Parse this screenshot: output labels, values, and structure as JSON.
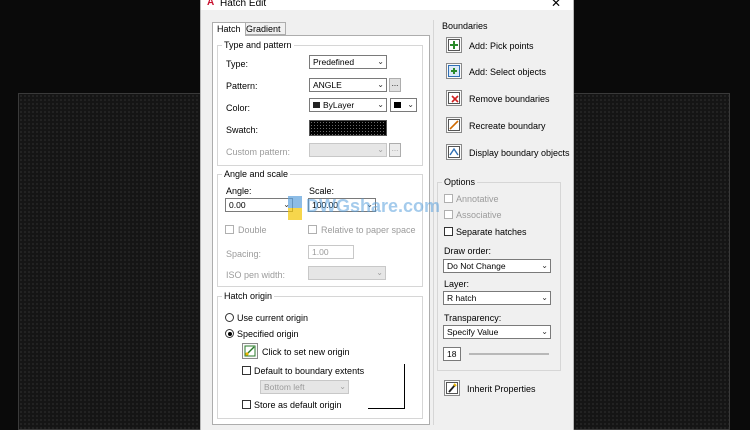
{
  "window": {
    "title": "Hatch Edit",
    "close": "✕"
  },
  "tabs": [
    {
      "label": "Hatch",
      "active": true
    },
    {
      "label": "Gradient",
      "active": false
    }
  ],
  "type_and_pattern": {
    "legend": "Type and pattern",
    "type_label": "Type:",
    "type_value": "Predefined",
    "pattern_label": "Pattern:",
    "pattern_value": "ANGLE",
    "pattern_browse": "...",
    "color_label": "Color:",
    "color_value": "ByLayer",
    "swatch_label": "Swatch:",
    "custom_pattern_label": "Custom pattern:",
    "custom_browse": "..."
  },
  "angle_and_scale": {
    "legend": "Angle and scale",
    "angle_label": "Angle:",
    "angle_value": "0.00",
    "scale_label": "Scale:",
    "scale_value": "100.00",
    "double_label": "Double",
    "relative_label": "Relative to paper space",
    "spacing_label": "Spacing:",
    "spacing_value": "1.00",
    "iso_label": "ISO pen width:"
  },
  "hatch_origin": {
    "legend": "Hatch origin",
    "use_current": "Use current origin",
    "specified": "Specified origin",
    "click_set": "Click to set new origin",
    "default_boundary": "Default to boundary extents",
    "bottom_left": "Bottom left",
    "store_default": "Store as default origin"
  },
  "boundaries": {
    "title": "Boundaries",
    "add_pick": "Add: Pick points",
    "add_select": "Add: Select objects",
    "remove": "Remove boundaries",
    "recreate": "Recreate boundary",
    "display": "Display boundary objects"
  },
  "options": {
    "title": "Options",
    "annotative": "Annotative",
    "associative": "Associative",
    "separate": "Separate hatches",
    "draw_order_label": "Draw order:",
    "draw_order_value": "Do Not Change",
    "layer_label": "Layer:",
    "layer_value": "R hatch",
    "transparency_label": "Transparency:",
    "transparency_value": "Specify Value",
    "transparency_amount": "18",
    "transparency_fraction": 0.18
  },
  "inherit": "Inherit Properties",
  "watermark": "DWGshare.com",
  "colors": {
    "dialog_bg": "#f0f0f0",
    "slider_accent": "#3d7bd8",
    "title_logo": "#c8102e"
  }
}
